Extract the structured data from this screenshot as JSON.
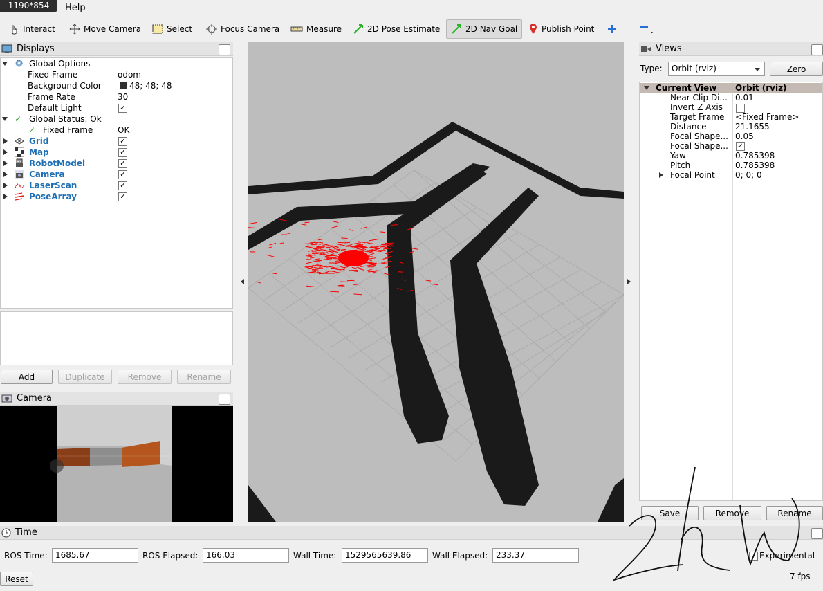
{
  "badge": "1190*854",
  "menu": {
    "help": "Help"
  },
  "toolbar": {
    "interact": "Interact",
    "move_camera": "Move Camera",
    "select": "Select",
    "focus_camera": "Focus Camera",
    "measure": "Measure",
    "pose_estimate": "2D Pose Estimate",
    "nav_goal": "2D Nav Goal",
    "publish_point": "Publish Point"
  },
  "displays": {
    "title": "Displays",
    "global_options": "Global Options",
    "fixed_frame_label": "Fixed Frame",
    "fixed_frame_value": "odom",
    "bg_color_label": "Background Color",
    "bg_color_value": "48; 48; 48",
    "frame_rate_label": "Frame Rate",
    "frame_rate_value": "30",
    "default_light_label": "Default Light",
    "global_status": "Global Status: Ok",
    "status_fixed_frame_label": "Fixed Frame",
    "status_fixed_frame_value": "OK",
    "items": [
      "Grid",
      "Map",
      "RobotModel",
      "Camera",
      "LaserScan",
      "PoseArray"
    ],
    "buttons": {
      "add": "Add",
      "duplicate": "Duplicate",
      "remove": "Remove",
      "rename": "Rename"
    }
  },
  "camera_panel": {
    "title": "Camera"
  },
  "views": {
    "title": "Views",
    "type_label": "Type:",
    "type_value": "Orbit (rviz)",
    "zero": "Zero",
    "current_view": "Current View",
    "current_view_value": "Orbit (rviz)",
    "props": [
      {
        "k": "Near Clip Di...",
        "v": "0.01"
      },
      {
        "k": "Invert Z Axis",
        "v": ""
      },
      {
        "k": "Target Frame",
        "v": "<Fixed Frame>"
      },
      {
        "k": "Distance",
        "v": "21.1655"
      },
      {
        "k": "Focal Shape...",
        "v": "0.05"
      },
      {
        "k": "Focal Shape...",
        "v": ""
      },
      {
        "k": "Yaw",
        "v": "0.785398"
      },
      {
        "k": "Pitch",
        "v": "0.785398"
      },
      {
        "k": "Focal Point",
        "v": "0; 0; 0"
      }
    ],
    "buttons": {
      "save": "Save",
      "remove": "Remove",
      "rename": "Rename"
    }
  },
  "time": {
    "title": "Time",
    "ros_time_label": "ROS Time:",
    "ros_time": "1685.67",
    "ros_elapsed_label": "ROS Elapsed:",
    "ros_elapsed": "166.03",
    "wall_time_label": "Wall Time:",
    "wall_time": "1529565639.86",
    "wall_elapsed_label": "Wall Elapsed:",
    "wall_elapsed": "233.37",
    "experimental": "Experimental",
    "fps": "7 fps",
    "reset": "Reset"
  },
  "colors": {
    "bg": "#303030",
    "floor": "#bdbdbd",
    "wall": "#1a1a1a",
    "particles": "#ff0000",
    "link": "#1f6fb5"
  }
}
